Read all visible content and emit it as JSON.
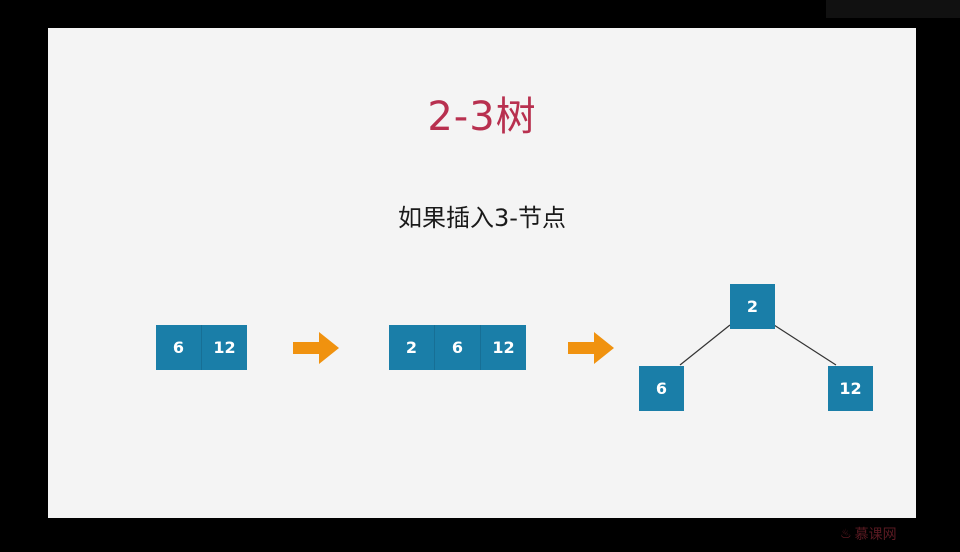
{
  "slide": {
    "title": "2-3树",
    "subtitle": "如果插入3-节点"
  },
  "step1": {
    "keys": [
      "6",
      "12"
    ]
  },
  "step2": {
    "keys": [
      "2",
      "6",
      "12"
    ]
  },
  "tree": {
    "root": "2",
    "left": "6",
    "right": "12"
  },
  "colors": {
    "node": "#1a7ea8",
    "arrow": "#f0920f",
    "title": "#b8304f"
  },
  "icons": [
    "arrow-right-icon",
    "arrow-right-icon",
    "flame-icon"
  ],
  "watermark": {
    "text": "慕课网"
  }
}
